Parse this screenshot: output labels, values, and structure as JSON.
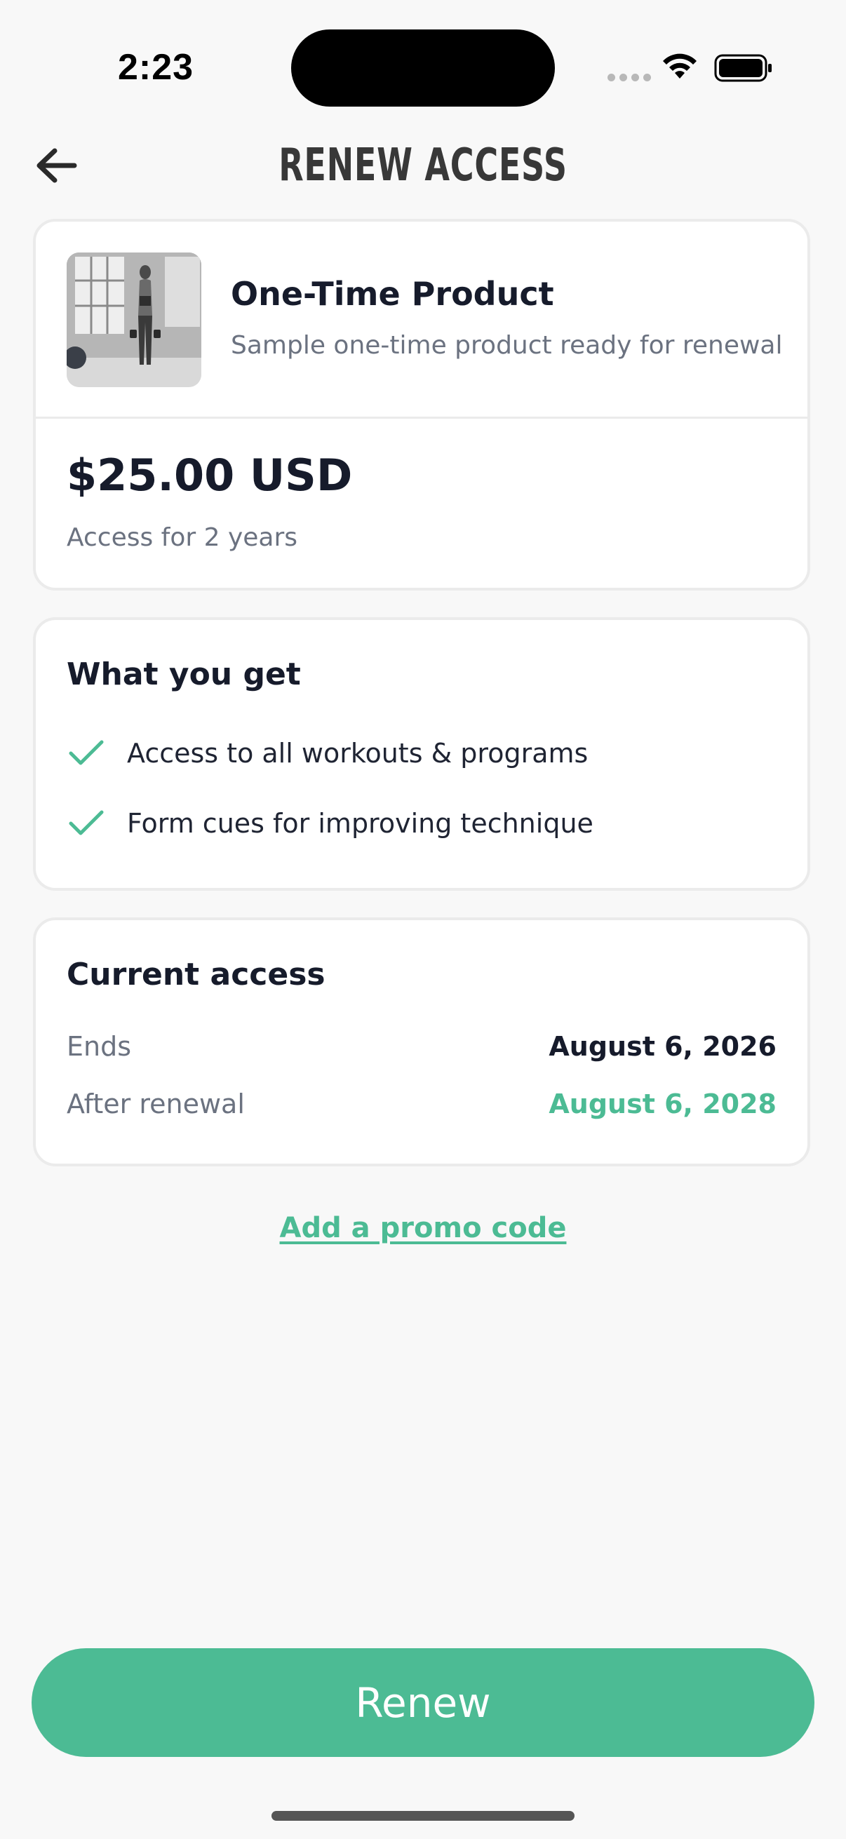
{
  "status_bar": {
    "time": "2:23",
    "icons": [
      "signal-dots-icon",
      "wifi-icon",
      "battery-icon"
    ]
  },
  "header": {
    "title": "RENEW ACCESS",
    "back_icon": "arrow-left-icon"
  },
  "product": {
    "image": "product-photo",
    "name": "One-Time Product",
    "description": "Sample one-time product ready for renewal",
    "price": "$25.00 USD",
    "duration": "Access for 2 years"
  },
  "benefits": {
    "heading": "What you get",
    "items": [
      {
        "icon": "checkmark-icon",
        "text": "Access to all workouts & programs"
      },
      {
        "icon": "checkmark-icon",
        "text": "Form cues for improving technique"
      }
    ]
  },
  "current_access": {
    "heading": "Current access",
    "rows": [
      {
        "label": "Ends",
        "value": "August 6, 2026"
      },
      {
        "label": "After renewal",
        "value": "August 6, 2028"
      }
    ]
  },
  "promo": {
    "link_label": "Add a promo code"
  },
  "actions": {
    "renew_label": "Renew"
  },
  "colors": {
    "accent": "#4cbb94",
    "background": "#f8f8f8",
    "card": "#ffffff",
    "text_primary": "#161b2b",
    "text_secondary": "#6b7280"
  }
}
